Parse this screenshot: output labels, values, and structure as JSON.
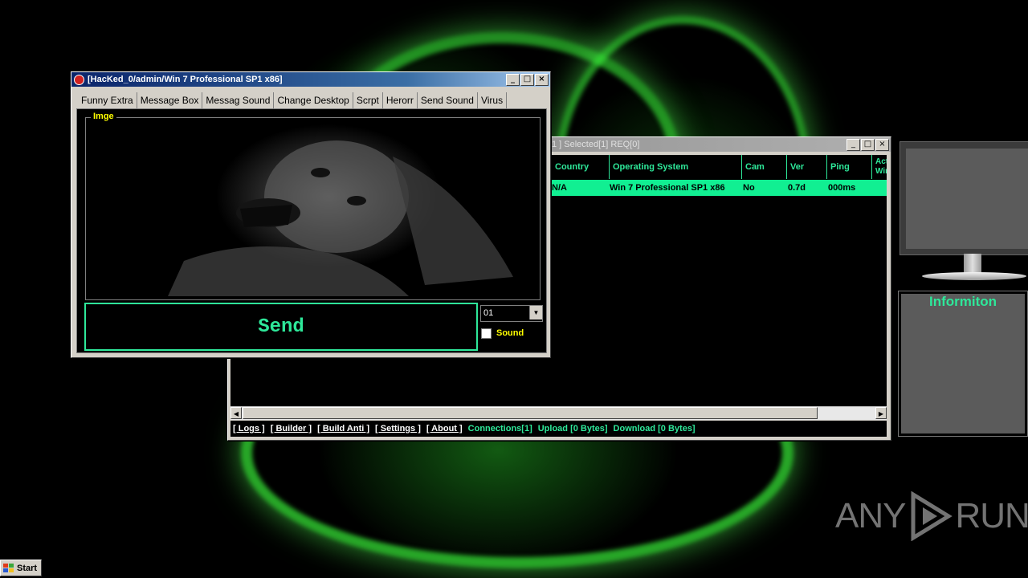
{
  "hack_window": {
    "title": "[HacKed_0/admin/Win 7 Professional SP1 x86]",
    "tabs": [
      "Funny Extra",
      "Message Box",
      "Messag Sound",
      "Change Desktop",
      "Scrpt",
      "Herorr",
      "Send Sound",
      "Virus"
    ],
    "active_tab": "Herorr",
    "image_group_label": "Imge",
    "send_label": "Send",
    "combo_value": "01",
    "sound_checkbox_label": "Sound",
    "sound_checked": false
  },
  "rat_window": {
    "title": "1 ]    Selected[1] REQ[0]",
    "columns": [
      "Country",
      "Operating System",
      "Cam",
      "Ver",
      "Ping",
      "Acti Win"
    ],
    "rows": [
      {
        "country": "N/A",
        "os": "Win 7 Professional SP1 x86",
        "cam": "No",
        "ver": "0.7d",
        "ping": "000ms",
        "active": ""
      }
    ],
    "status": {
      "logs": "[ Logs ]",
      "builder": "[ Builder ]",
      "build_anti": "[ Build Anti ]",
      "settings": "[ Settings ]",
      "about": "[ About ]",
      "connections": "Connections[1]",
      "upload": "Upload [0 Bytes]",
      "download": "Download [0 Bytes]"
    }
  },
  "side_panel": {
    "info_title": "Informiton"
  },
  "watermark": {
    "left": "ANY",
    "right": "RUN"
  },
  "taskbar": {
    "start_label": "Start"
  },
  "colors": {
    "accent_green": "#2ee89a",
    "selected_row": "#11ef92",
    "label_yellow": "#ffff00"
  }
}
